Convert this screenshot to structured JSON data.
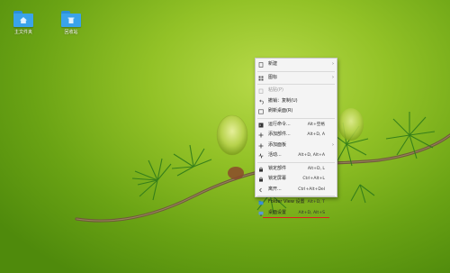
{
  "desktop": {
    "icons": [
      {
        "label": "主文件夹",
        "icon": "home-folder-icon"
      },
      {
        "label": "回收站",
        "icon": "trash-folder-icon"
      }
    ]
  },
  "context_menu": {
    "items": [
      {
        "label": "新建",
        "shortcut": "",
        "submenu": true,
        "disabled": false,
        "icon": "new-icon"
      },
      {
        "label": "图标",
        "shortcut": "",
        "submenu": true,
        "disabled": false,
        "icon": "grid-icon"
      },
      {
        "label": "粘贴(P)",
        "shortcut": "",
        "submenu": false,
        "disabled": true,
        "icon": "paste-icon"
      },
      {
        "label": "撤销：复制(U)",
        "shortcut": "",
        "submenu": false,
        "disabled": false,
        "icon": "undo-icon"
      },
      {
        "label": "刷新桌面(R)",
        "shortcut": "",
        "submenu": false,
        "disabled": false,
        "icon": "refresh-icon"
      },
      {
        "label": "运行命令...",
        "shortcut": "Alt+空格",
        "submenu": false,
        "disabled": false,
        "icon": "run-icon"
      },
      {
        "label": "添加部件...",
        "shortcut": "Alt+D, A",
        "submenu": false,
        "disabled": false,
        "icon": "add-widget-icon"
      },
      {
        "label": "添加面板",
        "shortcut": "",
        "submenu": true,
        "disabled": false,
        "icon": "add-panel-icon"
      },
      {
        "label": "活动...",
        "shortcut": "Alt+D, Alt+A",
        "submenu": false,
        "disabled": false,
        "icon": "activities-icon"
      },
      {
        "label": "锁定部件",
        "shortcut": "Alt+D, L",
        "submenu": false,
        "disabled": false,
        "icon": "lock-icon"
      },
      {
        "label": "锁定屏幕",
        "shortcut": "Ctrl+Alt+L",
        "submenu": false,
        "disabled": false,
        "icon": "lock-screen-icon"
      },
      {
        "label": "离开...",
        "shortcut": "Ctrl+Alt+Del",
        "submenu": false,
        "disabled": false,
        "icon": "leave-icon"
      },
      {
        "label": "Folder View 设置",
        "shortcut": "Alt+D, T",
        "submenu": false,
        "disabled": false,
        "icon": "folder-view-settings-icon"
      },
      {
        "label": "桌面设置",
        "shortcut": "Alt+D, Alt+S",
        "submenu": false,
        "disabled": false,
        "icon": "desktop-settings-icon",
        "underlined": true
      }
    ],
    "separators_after": [
      0,
      1,
      4,
      8,
      11
    ],
    "highlight_color": "#e02020"
  }
}
